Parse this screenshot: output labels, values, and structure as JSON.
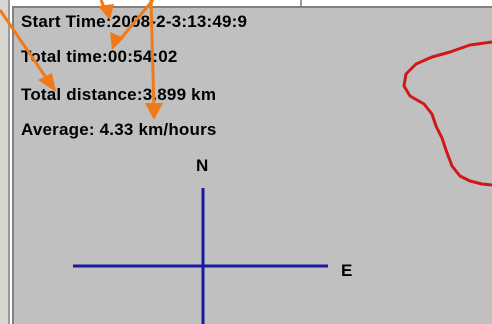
{
  "info": {
    "start_time": "Start Time:2008-2-3:13:49:9",
    "total_time": "Total time:00:54:02",
    "total_distance": "Total distance:3.899 km",
    "average": "Average: 4.33 km/hours"
  },
  "compass": {
    "north": "N",
    "east": "E",
    "color": "#1a1aa0"
  },
  "track": {
    "color": "#d01818"
  },
  "annotation": {
    "arrow_color": "#f07a1a"
  },
  "colors": {
    "panel_background": "#c0c0c0"
  }
}
